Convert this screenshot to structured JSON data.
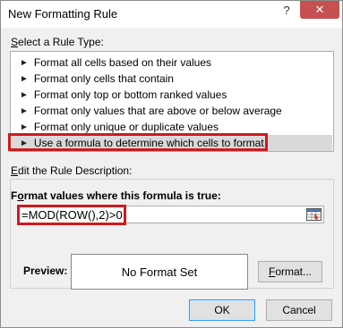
{
  "window": {
    "title": "New Formatting Rule",
    "help_label": "?",
    "close_label": "✕"
  },
  "rule_type": {
    "label_prefix": "S",
    "label_rest": "elect a Rule Type:",
    "items": [
      {
        "label": "Format all cells based on their values",
        "selected": false
      },
      {
        "label": "Format only cells that contain",
        "selected": false
      },
      {
        "label": "Format only top or bottom ranked values",
        "selected": false
      },
      {
        "label": "Format only values that are above or below average",
        "selected": false
      },
      {
        "label": "Format only unique or duplicate values",
        "selected": false
      },
      {
        "label": "Use a formula to determine which cells to format",
        "selected": true
      }
    ],
    "bullet": "►"
  },
  "description": {
    "label_prefix": "E",
    "label_rest": "dit the Rule Description:",
    "formula_label_prefix": "F",
    "formula_label_mid": "o",
    "formula_label_rest": "rmat values where this formula is true:",
    "formula_value": "=MOD(ROW(),2)>0",
    "preview_label": "Preview:",
    "preview_text": "No Format Set",
    "format_button_prefix": "F",
    "format_button_rest": "ormat..."
  },
  "buttons": {
    "ok": "OK",
    "cancel": "Cancel"
  },
  "colors": {
    "highlight": "#d0191e",
    "close_button": "#c75050",
    "selected_row": "#d9d9d9"
  }
}
